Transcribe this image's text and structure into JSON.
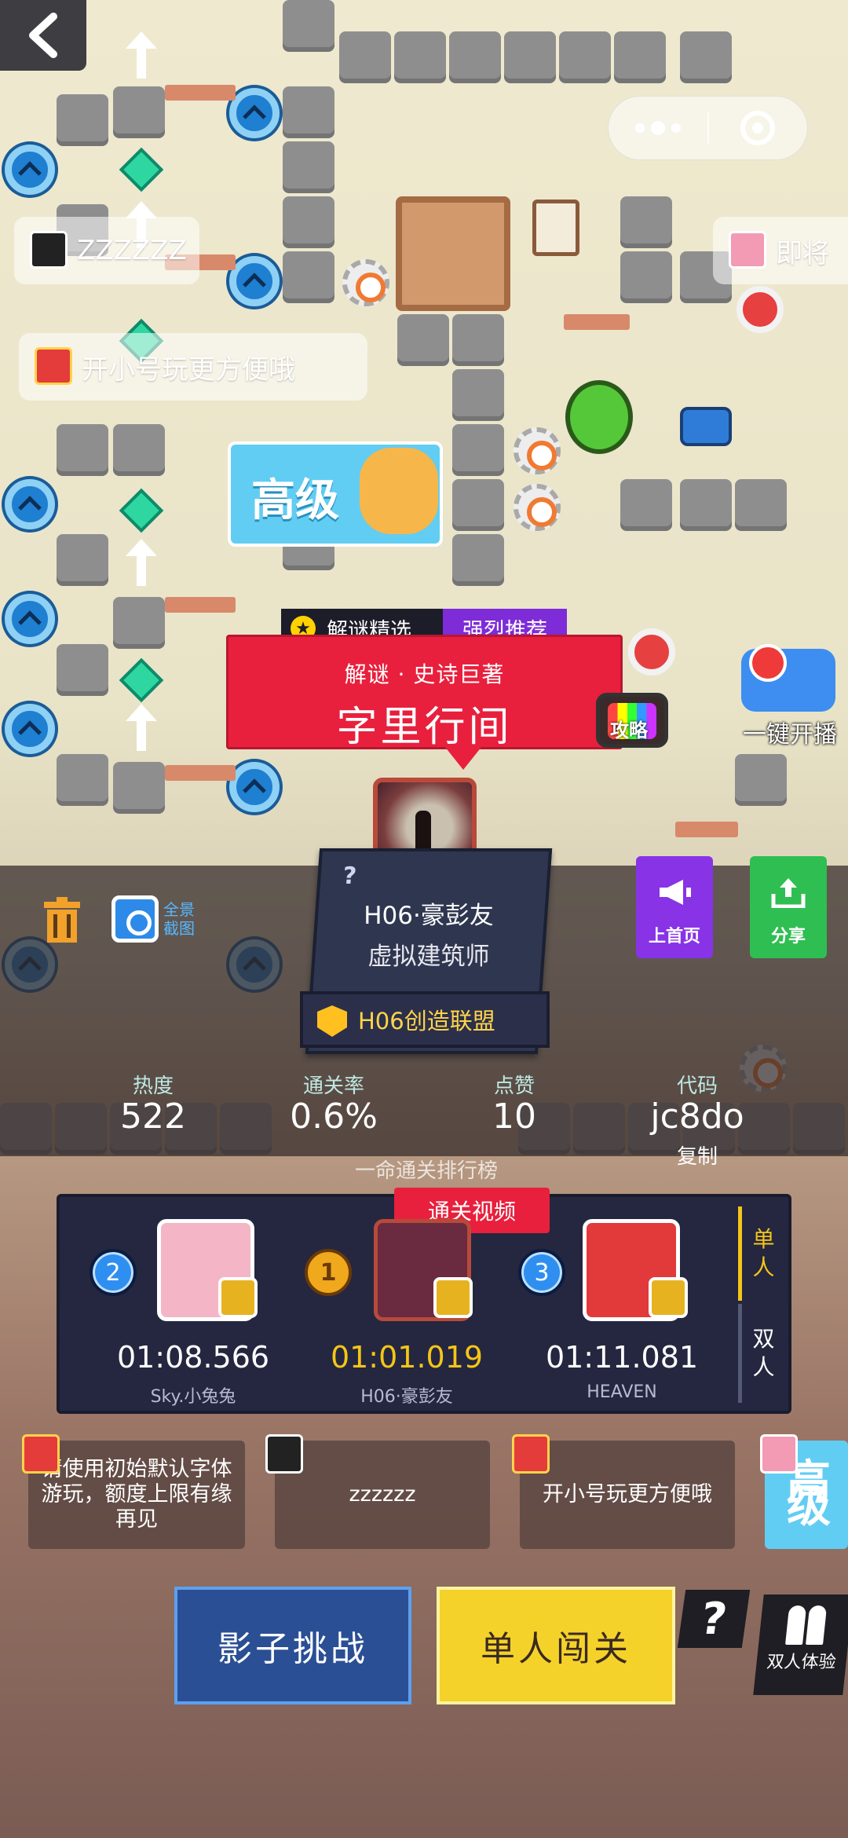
{
  "top_bar": {
    "back_icon": "chevron-left-icon",
    "capsule_more_icon": "more-dots-icon",
    "capsule_close_icon": "target-close-icon"
  },
  "danmaku": [
    {
      "text": "ZZZZZZ"
    },
    {
      "text": "开小号玩更方便哦"
    },
    {
      "text": "即将"
    }
  ],
  "scene_badge": {
    "text": "高级"
  },
  "tags": {
    "featured": "解谜精选",
    "recommend": "强烈推荐"
  },
  "level": {
    "subtitle": "解谜 · 史诗巨著",
    "title": "字里行间"
  },
  "strategy_label": "攻略",
  "live_label": "一键开播",
  "author": {
    "question_mark": "?",
    "name": "H06·豪彭友",
    "title": "虚拟建筑师",
    "guild": "H06创造联盟"
  },
  "side_buttons": {
    "homepage": "上首页",
    "share": "分享"
  },
  "tools": {
    "panorama_label": "全景截图"
  },
  "stats": [
    {
      "label": "热度",
      "value": "522"
    },
    {
      "label": "通关率",
      "value": "0.6%"
    },
    {
      "label": "点赞",
      "value": "10"
    },
    {
      "label": "代码",
      "value": "jc8do"
    }
  ],
  "copy_label": "复制",
  "rank_link": "一命通关排行榜",
  "leaderboard": {
    "video_tag": "通关视频",
    "entries": [
      {
        "rank": "2",
        "time": "01:08.566",
        "name": "Sky.小兔兔"
      },
      {
        "rank": "1",
        "time": "01:01.019",
        "name": "H06·豪彭友"
      },
      {
        "rank": "3",
        "time": "01:11.081",
        "name": "HEAVEN"
      }
    ],
    "mode_single": [
      "单",
      "人"
    ],
    "mode_double": [
      "双",
      "人"
    ]
  },
  "comments": [
    {
      "text": "请使用初始默认字体游玩，额度上限有缘再见"
    },
    {
      "text": "zzzzzz"
    },
    {
      "text": "开小号玩更方便哦"
    },
    {
      "text": "高级"
    }
  ],
  "buttons": {
    "shadow": "影子挑战",
    "solo": "单人闯关",
    "help": "?",
    "duo": "双人体验"
  },
  "colors": {
    "banner_red": "#e8203d",
    "solo_yellow": "#f5d22a",
    "shadow_blue": "#2b4f94",
    "homepage_purple": "#8833e6",
    "share_green": "#2fbe52",
    "gold_time": "#f5c518"
  }
}
